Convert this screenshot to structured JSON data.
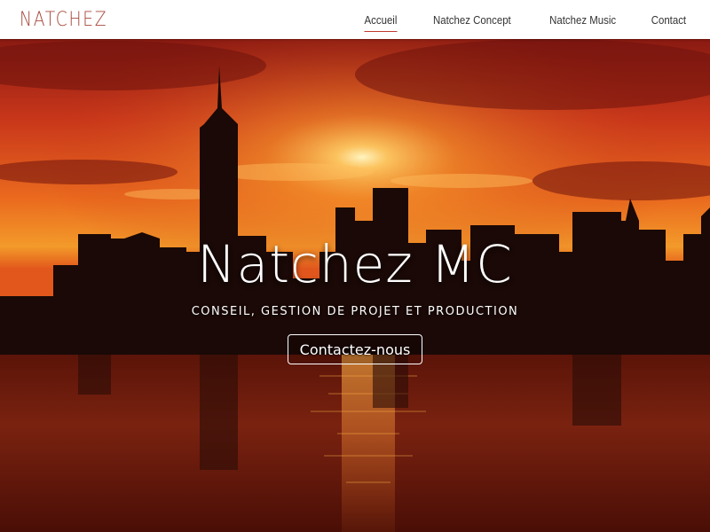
{
  "brand": {
    "logo_text": "NATCHEZ",
    "logo_color": "#a5483a"
  },
  "nav": {
    "items": [
      {
        "label": "Accueil",
        "active": true
      },
      {
        "label": "Natchez Concept",
        "active": false
      },
      {
        "label": "Natchez Music",
        "active": false
      },
      {
        "label": "Contact",
        "active": false
      }
    ],
    "active_underline_color": "#c0392b"
  },
  "hero": {
    "title": "Natchez MC",
    "subtitle": "CONSEIL, GESTION DE PROJET ET PRODUCTION",
    "cta_label": "Contactez-nous",
    "background": "sunset-city-skyline-over-water"
  }
}
